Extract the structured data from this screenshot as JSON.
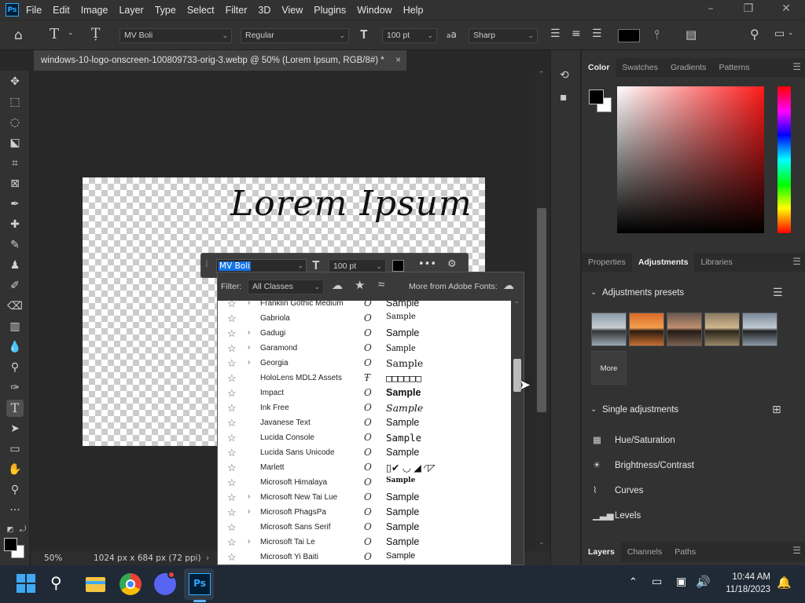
{
  "menubar": {
    "logo": "Ps",
    "items": [
      "File",
      "Edit",
      "Image",
      "Layer",
      "Type",
      "Select",
      "Filter",
      "3D",
      "View",
      "Plugins",
      "Window",
      "Help"
    ],
    "controls": {
      "minimize": "–",
      "restore": "❐",
      "close": "✕"
    }
  },
  "options": {
    "font_family": "MV Boli",
    "font_style": "Regular",
    "font_size": "100 pt",
    "aa_label": "a",
    "antialias": "Sharp"
  },
  "document": {
    "tab_title": "windows-10-logo-onscreen-100809733-orig-3.webp @ 50% (Lorem Ipsum, RGB/8#) *",
    "tab_close": "×",
    "canvas_text": "Lorem Ipsum",
    "zoom": "50%",
    "dimensions": "1024 px x 684 px (72 ppi)"
  },
  "font_popup": {
    "font_name": "MV Boli",
    "font_size": "100 pt",
    "filter_label": "Filter:",
    "filter_value": "All Classes",
    "more_fonts": "More from Adobe Fonts:",
    "fonts": [
      {
        "name": "Franklin Gothic Medium",
        "expand": true,
        "sample": "Sample"
      },
      {
        "name": "Gabriola",
        "expand": false,
        "sample": "Sample"
      },
      {
        "name": "Gadugi",
        "expand": true,
        "sample": "Sample"
      },
      {
        "name": "Garamond",
        "expand": true,
        "sample": "Sample"
      },
      {
        "name": "Georgia",
        "expand": true,
        "sample": "Sample"
      },
      {
        "name": "HoloLens MDL2 Assets",
        "expand": false,
        "sample": "□□□□□□"
      },
      {
        "name": "Impact",
        "expand": false,
        "sample": "Sample"
      },
      {
        "name": "Ink Free",
        "expand": false,
        "sample": "Sample"
      },
      {
        "name": "Javanese Text",
        "expand": false,
        "sample": "Sample"
      },
      {
        "name": "Lucida Console",
        "expand": false,
        "sample": "Sample"
      },
      {
        "name": "Lucida Sans Unicode",
        "expand": false,
        "sample": "Sample"
      },
      {
        "name": "Marlett",
        "expand": false,
        "sample": "▯✔ ◡ ◢ ◜◸"
      },
      {
        "name": "Microsoft Himalaya",
        "expand": false,
        "sample": "Sample"
      },
      {
        "name": "Microsoft New Tai Lue",
        "expand": true,
        "sample": "Sample"
      },
      {
        "name": "Microsoft PhagsPa",
        "expand": true,
        "sample": "Sample"
      },
      {
        "name": "Microsoft Sans Serif",
        "expand": false,
        "sample": "Sample"
      },
      {
        "name": "Microsoft Tai Le",
        "expand": true,
        "sample": "Sample"
      },
      {
        "name": "Microsoft Yi Baiti",
        "expand": false,
        "sample": "Sample"
      }
    ]
  },
  "color_panel": {
    "tabs": [
      "Color",
      "Swatches",
      "Gradients",
      "Patterns"
    ],
    "foreground": "#000000",
    "background": "#ffffff"
  },
  "adjust_panel": {
    "tabs": [
      "Properties",
      "Adjustments",
      "Libraries"
    ],
    "presets_title": "Adjustments presets",
    "more_label": "More",
    "single_title": "Single adjustments",
    "items": [
      "Hue/Saturation",
      "Brightness/Contrast",
      "Curves",
      "Levels"
    ]
  },
  "layers_panel": {
    "tabs": [
      "Layers",
      "Channels",
      "Paths"
    ]
  },
  "taskbar": {
    "time": "10:44 AM",
    "date": "11/18/2023"
  }
}
